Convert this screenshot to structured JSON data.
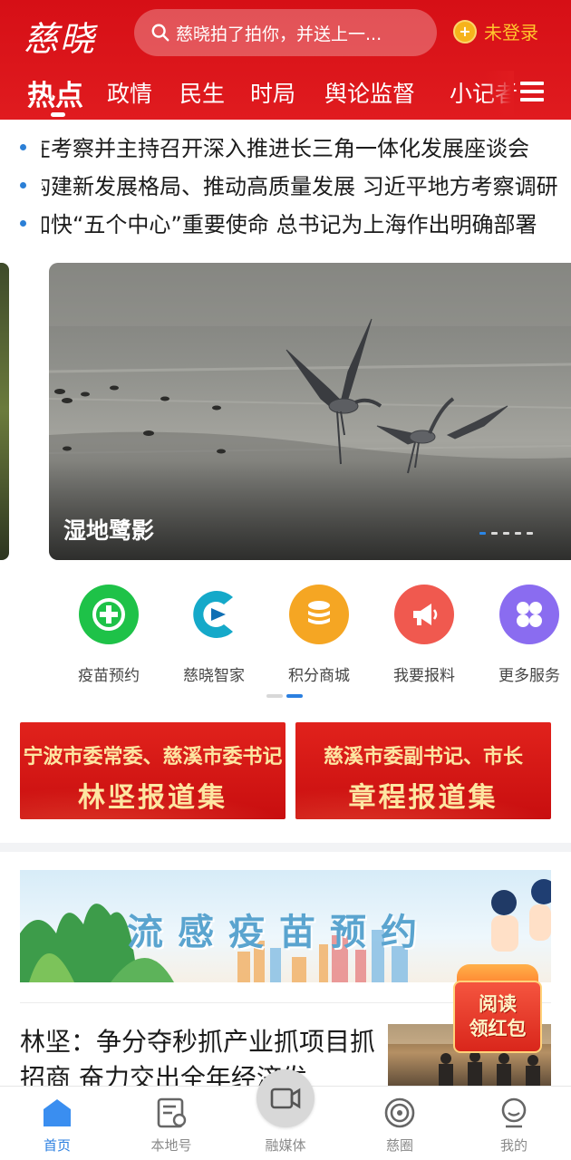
{
  "header": {
    "logo": "慈晓",
    "search_text": "慈晓拍了拍你，并送上一...",
    "login_label": "未登录",
    "tabs": [
      "热点",
      "政情",
      "民生",
      "时局",
      "舆论监督",
      "小记者"
    ]
  },
  "headlines": [
    "在考察并主持召开深入推进长三角一体化发展座谈会",
    "构建新发展格局、推动高质量发展  习近平地方考察调研",
    "加快“五个中心”重要使命  总书记为上海作出明确部署"
  ],
  "carousel": {
    "caption": "湿地鹭影",
    "dot_count": 5,
    "active_dot": 0
  },
  "services": [
    {
      "label": "疫苗预约",
      "icon": "plus-circle-icon",
      "color": "#1ec248"
    },
    {
      "label": "慈晓智家",
      "icon": "cixiao-home-logo-icon",
      "color": "#17a8c6"
    },
    {
      "label": "积分商城",
      "icon": "coin-stack-icon",
      "color": "#f5a623"
    },
    {
      "label": "我要报料",
      "icon": "megaphone-icon",
      "color": "#f0594f"
    },
    {
      "label": "更多服务",
      "icon": "four-grid-icon",
      "color": "#8a6cf0"
    }
  ],
  "promos": [
    {
      "line1": "宁波市委常委、慈溪市委书记",
      "line2": "林坚报道集"
    },
    {
      "line1": "慈溪市委副书记、市长",
      "line2": "章程报道集"
    }
  ],
  "vaccine_banner": {
    "title": "流感疫苗预约"
  },
  "news": {
    "title": "林坚：争分夺秒抓产业抓项目抓招商  奋力交出全年经济发"
  },
  "red_packet": {
    "line1": "阅读",
    "line2": "领红包"
  },
  "bottom_nav": [
    {
      "label": "首页",
      "icon": "home-icon",
      "active": true
    },
    {
      "label": "本地号",
      "icon": "local-account-icon",
      "active": false
    },
    {
      "label": "融媒体",
      "icon": "video-camera-icon",
      "active": false
    },
    {
      "label": "慈圈",
      "icon": "circle-target-icon",
      "active": false
    },
    {
      "label": "我的",
      "icon": "user-profile-icon",
      "active": false
    }
  ],
  "colors": {
    "brand_red": "#e01b1f",
    "accent_blue": "#2b7fe0",
    "login_gold": "#ffc52d"
  }
}
